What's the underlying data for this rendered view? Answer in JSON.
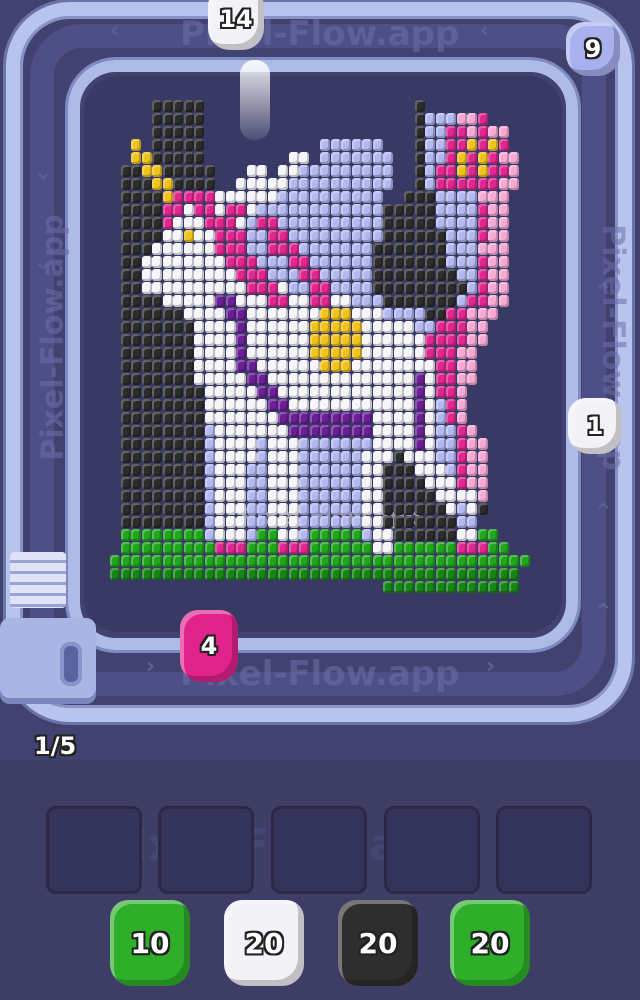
{
  "watermark": "Pixel-Flow.app",
  "queue_counter": "1/5",
  "shooters_on_track": [
    {
      "count": "14",
      "color": "#f2f2f7",
      "ear": "#dcdcea",
      "name": "white"
    },
    {
      "count": "9",
      "color": "#a8b0ee",
      "ear": "#8d96dc",
      "name": "lavender"
    },
    {
      "count": "1",
      "color": "#f2f2f7",
      "ear": "#dcdcea",
      "name": "white"
    },
    {
      "count": "4",
      "color": "#e0238a",
      "ear": "#c81a78",
      "name": "magenta"
    }
  ],
  "empty_slots": 5,
  "queue": [
    {
      "count": "10",
      "color": "#2fae2a",
      "name": "green"
    },
    {
      "count": "20",
      "color": "#f2f2f7",
      "name": "white"
    },
    {
      "count": "20",
      "color": "#2e2e2e",
      "name": "black"
    },
    {
      "count": "20",
      "color": "#2fae2a",
      "name": "green"
    }
  ],
  "palette": {
    "K": "#2c2c2c",
    "W": "#f5f5fa",
    "L": "#b3b9f0",
    "P": "#e0278f",
    "p": "#f6a9d3",
    "Y": "#f0c21e",
    "G": "#20a61c",
    "g": "#178516",
    "V": "#6a1f96"
  },
  "pixel_rows": [
    "....KKKKK....................K..........",
    "....KKKKK....................KLLLppP....",
    "....KKKKK....................KLLPPpPpp..",
    "..Y.KKKKK...........LLLLLL...KLLPPYPYP..",
    "..YYKKKKK........WW.LLLLLLL..KLLPYPYPpp.",
    ".KKYYKKKKK...WW.WWLLLLLLLLL..KLPPYPYPPp.",
    ".KKKYYKKKK..WWWWWLLLLLLLLLL..KLPPPPPPpp.",
    ".KKKKYPPPPWWWWWWLLLLLLLLLL..KKKLLLLppp..",
    ".KKKKPPWPPWPPWLLLLLLLLLLLLKKKKKLLLLPpp..",
    ".KKKKPWWWPPPWLPPLLLLLLLLLLKKKKKLLLLPpp..",
    ".KKKKWWYWWPPPLLPPLLLLLLLLLKKKKKKLLLPpp..",
    ".KKKWWWWWWPPPLLPPPLLLLLLLKKKKKKKLLLppp..",
    ".KKWWWWWWWWPPPLLLPPLLLLLLKKKKKKKLLLPpp..",
    ".KKWWWWWWWWWPPPLLLPPLLLLLKKKKKKKKLLPpp..",
    ".KKWWWWWWWWWWPPPWLLPPLLLLKKKKKKKKKLPpp..",
    ".KKKKWWWWWVVWWWPPWWPPWWLLLKKKKKKKLPPpp..",
    ".KKKKKKWWWWVVWWWWWWWYYYWWWLLLLKKPPppp...",
    ".KKKKKKKWWWWVWWWWWWYYYYYWWWWWLLPPPpp....",
    ".KKKKKKKWWWWVWWWWWWYYYYYWWWWWWPPPPpp....",
    ".KKKKKKKWWWWVWWWWWWYYYYYWWWWWWPPPpp.....",
    ".KKKKKKKWWWWVVWWWWWWYYYWWWWWWWWPPpp.....",
    ".KKKKKKKWWWWWVVWWWWWWWWWWWWWWVWPPpp.....",
    ".KKKKKKKKWWWWWVVWWWWWWWWWWWWWVWPPp......",
    ".KKKKKKKKWWWWWWVVWWWWWWWWWWWWVWLPp......",
    ".KKKKKKKKWWWWWWWVVVVVVVVVWWWWVWLPp......",
    ".KKKKKKKKLWWWWWWWVVVVVVVVWWWWVWLLPp.....",
    ".KKKKKKKKLWWWWLWWWLLLLLLLWWWWVWLLPpp....",
    ".KKKKKKKKLWWWWLWWWLLLLLLWWWKWWWLLPpp....",
    ".KKKKKKKKLWWWLLWWWLLLLLLWWKKKWWWLPpp....",
    ".KKKKKKKKLWWWLLWWWLLLLLLWWKKKKWWWPpp....",
    ".KKKKKKKKLWWWLLWWWLLLLLLWWKKKKKWWWWp....",
    ".KKKKKKKKLWWWLLWWWLLLLLLWWKKKKKKWLWK....",
    ".KKKKKKKKLWWWLLWWWLLLLLLWWKKKKKKKLL.....",
    ".GGGGGGGGLWWWLGGWWLGGGGGLWWKKKKKKWWGG...",
    ".GGGGGGGGGPPPGGGPPPGGGGGGWWGGGGGGPPPGG..",
    "GGGGGGGGGGGGGGGGGGGGGGGGGGGGGGGGGGGGGGGG",
    "ggggggggggggggggggggggggggggggggggggggg.",
    "..........................ggggggggggggg."
  ]
}
